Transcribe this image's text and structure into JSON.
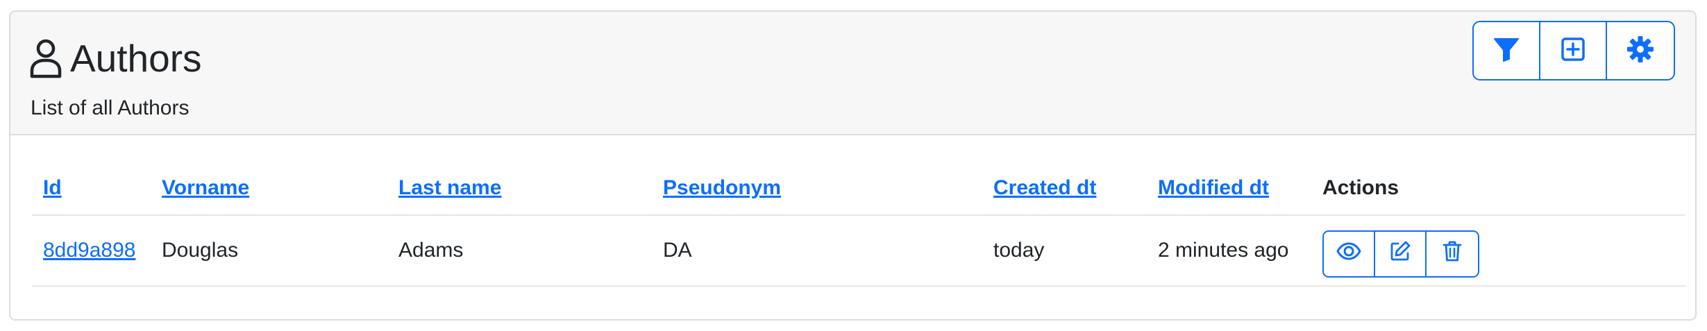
{
  "header": {
    "title": "Authors",
    "subtitle": "List of all Authors",
    "title_icon": "person-icon",
    "toolbar": [
      {
        "name": "filter-button",
        "icon": "filter-icon"
      },
      {
        "name": "add-button",
        "icon": "plus-square-icon"
      },
      {
        "name": "settings-button",
        "icon": "gear-icon"
      }
    ]
  },
  "table": {
    "columns": {
      "id": "Id",
      "vorname": "Vorname",
      "last_name": "Last name",
      "pseudonym": "Pseudonym",
      "created_dt": "Created dt",
      "modified_dt": "Modified dt",
      "actions": "Actions"
    },
    "rows": [
      {
        "id": "8dd9a898",
        "vorname": "Douglas",
        "last_name": "Adams",
        "pseudonym": "DA",
        "created_dt": "today",
        "modified_dt": "2 minutes ago",
        "actions": [
          "eye-icon",
          "pencil-icon",
          "trash-icon"
        ]
      }
    ]
  },
  "colors": {
    "accent": "#0d6efd",
    "header_bg": "#f7f7f7",
    "border": "#dcdcdc",
    "text": "#212529"
  }
}
